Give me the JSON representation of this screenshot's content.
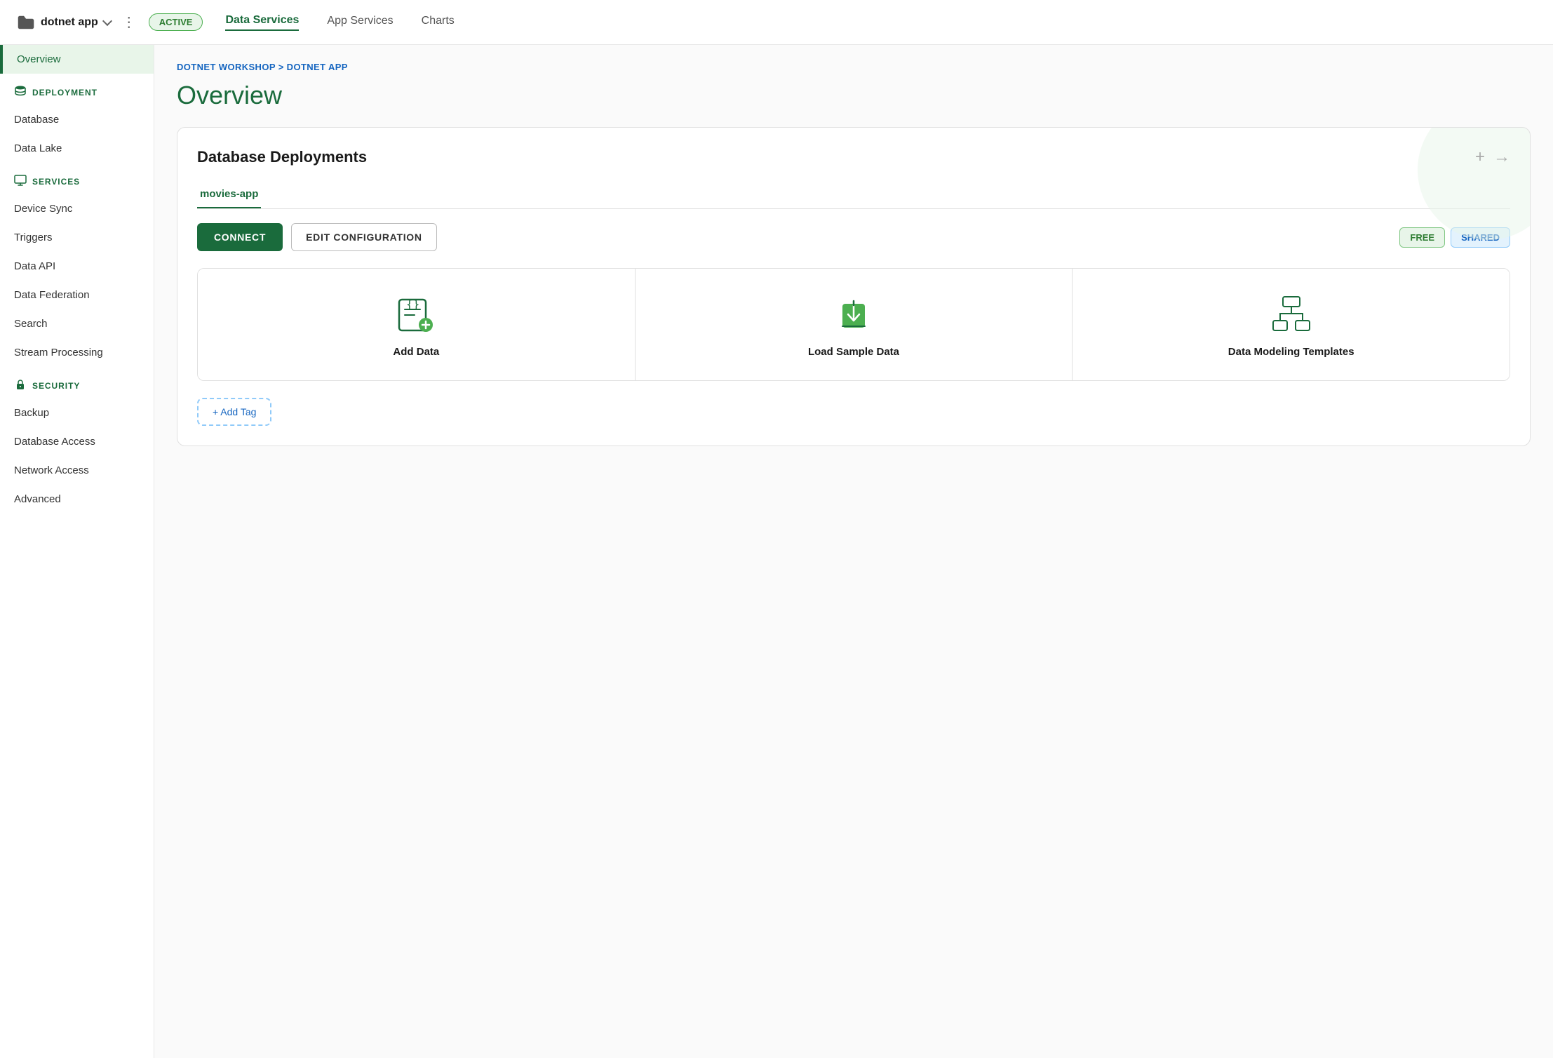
{
  "topNav": {
    "appName": "dotnet app",
    "activeBadge": "ACTIVE",
    "tabs": [
      {
        "label": "Data Services",
        "active": true
      },
      {
        "label": "App Services",
        "active": false
      },
      {
        "label": "Charts",
        "active": false
      }
    ],
    "dotsLabel": "⋮"
  },
  "sidebar": {
    "activeItem": "Overview",
    "overviewLabel": "Overview",
    "sections": [
      {
        "header": "DEPLOYMENT",
        "iconType": "database",
        "items": [
          "Database",
          "Data Lake"
        ]
      },
      {
        "header": "SERVICES",
        "iconType": "monitor",
        "items": [
          "Device Sync",
          "Triggers",
          "Data API",
          "Data Federation",
          "Search",
          "Stream Processing"
        ]
      },
      {
        "header": "SECURITY",
        "iconType": "lock",
        "items": [
          "Backup",
          "Database Access",
          "Network Access",
          "Advanced"
        ]
      }
    ]
  },
  "breadcrumb": {
    "org": "DOTNET WORKSHOP",
    "separator": " > ",
    "app": "DOTNET APP"
  },
  "pageTitle": "Overview",
  "card": {
    "title": "Database Deployments",
    "addIconLabel": "+",
    "arrowIconLabel": "→",
    "tab": "movies-app",
    "connectBtn": "CONNECT",
    "editBtn": "EDIT CONFIGURATION",
    "freeBadge": "FREE",
    "sharedBadge": "SHARED",
    "options": [
      {
        "label": "Add Data"
      },
      {
        "label": "Load Sample Data"
      },
      {
        "label": "Data Modeling Templates"
      }
    ],
    "addTagBtn": "+ Add Tag"
  },
  "colors": {
    "green": "#1a6b3c",
    "lightGreen": "#e8f5e9",
    "blue": "#1565c0"
  }
}
